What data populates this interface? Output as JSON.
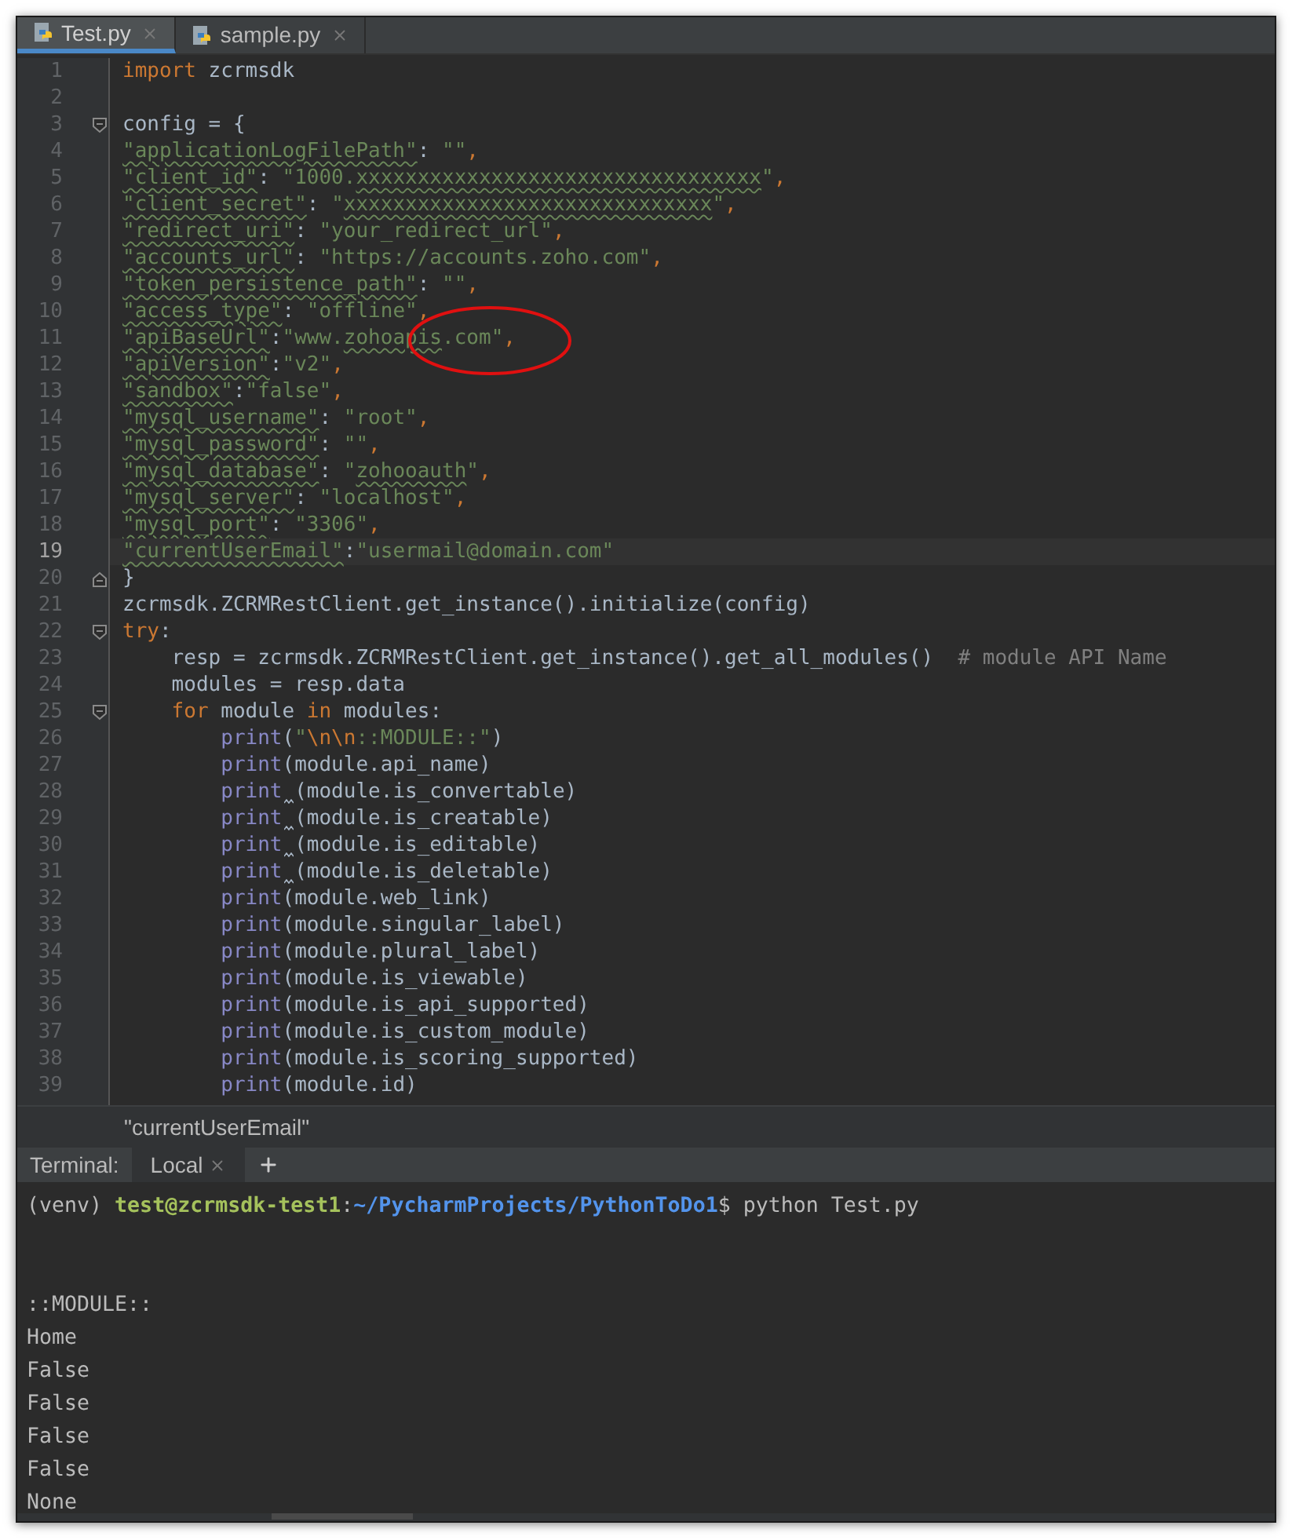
{
  "editor_tabs": [
    {
      "label": "Test.py",
      "selected": true
    },
    {
      "label": "sample.py",
      "selected": false
    }
  ],
  "code_lines": [
    {
      "number": "1",
      "tokens": [
        {
          "text": "import",
          "kind": "keyword"
        },
        {
          "text": " zcrmsdk",
          "kind": "plain"
        }
      ]
    },
    {
      "number": "2"
    },
    {
      "number": "3",
      "fold": {
        "kind": "start"
      },
      "tokens": [
        {
          "text": "config = {",
          "kind": "plain"
        }
      ]
    },
    {
      "number": "4",
      "tokens": [
        {
          "text": "\"applicationLogFilePath\"",
          "kind": "string",
          "warned": true
        },
        {
          "text": ": ",
          "kind": "plain"
        },
        {
          "text": "\"\"",
          "kind": "string"
        },
        {
          "text": ",",
          "kind": "punct"
        }
      ]
    },
    {
      "number": "5",
      "tokens": [
        {
          "text": "\"client_id\"",
          "kind": "string",
          "warned": true
        },
        {
          "text": ": ",
          "kind": "plain"
        },
        {
          "text": "\"1000.",
          "kind": "string"
        },
        {
          "text": "xxxxxxxxxxxxxxxxxxxxxxxxxxxxxxxxx",
          "kind": "string",
          "warned": true
        },
        {
          "text": "\"",
          "kind": "string"
        },
        {
          "text": ",",
          "kind": "punct"
        }
      ]
    },
    {
      "number": "6",
      "tokens": [
        {
          "text": "\"client_secret\"",
          "kind": "string",
          "warned": true
        },
        {
          "text": ": ",
          "kind": "plain"
        },
        {
          "text": "\"",
          "kind": "string"
        },
        {
          "text": "xxxxxxxxxxxxxxxxxxxxxxxxxxxxxx",
          "kind": "string",
          "warned": true
        },
        {
          "text": "\"",
          "kind": "string"
        },
        {
          "text": ",",
          "kind": "punct"
        }
      ]
    },
    {
      "number": "7",
      "tokens": [
        {
          "text": "\"redirect_uri\"",
          "kind": "string",
          "warned": true
        },
        {
          "text": ": ",
          "kind": "plain"
        },
        {
          "text": "\"your_redirect_url\"",
          "kind": "string"
        },
        {
          "text": ",",
          "kind": "punct"
        }
      ]
    },
    {
      "number": "8",
      "tokens": [
        {
          "text": "\"accounts_url\"",
          "kind": "string",
          "warned": true
        },
        {
          "text": ": ",
          "kind": "plain"
        },
        {
          "text": "\"https://accounts.zoho.com\"",
          "kind": "string"
        },
        {
          "text": ",",
          "kind": "punct"
        }
      ]
    },
    {
      "number": "9",
      "tokens": [
        {
          "text": "\"token_persistence_path\"",
          "kind": "string",
          "warned": true
        },
        {
          "text": ": ",
          "kind": "plain"
        },
        {
          "text": "\"\"",
          "kind": "string"
        },
        {
          "text": ",",
          "kind": "punct"
        }
      ]
    },
    {
      "number": "10",
      "tokens": [
        {
          "text": "\"access_type\"",
          "kind": "string",
          "warned": true
        },
        {
          "text": ": ",
          "kind": "plain"
        },
        {
          "text": "\"offline\"",
          "kind": "string"
        },
        {
          "text": ",",
          "kind": "punct"
        }
      ]
    },
    {
      "number": "11",
      "tokens": [
        {
          "text": "\"apiBaseUrl\"",
          "kind": "string",
          "warned": true
        },
        {
          "text": ":",
          "kind": "plain"
        },
        {
          "text": "\"www.",
          "kind": "string"
        },
        {
          "text": "zohoapis",
          "kind": "string",
          "warned": true
        },
        {
          "text": ".com\"",
          "kind": "string"
        },
        {
          "text": ",",
          "kind": "punct"
        }
      ]
    },
    {
      "number": "12",
      "tokens": [
        {
          "text": "\"apiVersion\"",
          "kind": "string",
          "warned": true
        },
        {
          "text": ":",
          "kind": "plain"
        },
        {
          "text": "\"v2\"",
          "kind": "string"
        },
        {
          "text": ",",
          "kind": "punct"
        }
      ]
    },
    {
      "number": "13",
      "tokens": [
        {
          "text": "\"sandbox\"",
          "kind": "string",
          "warned": true
        },
        {
          "text": ":",
          "kind": "plain"
        },
        {
          "text": "\"false\"",
          "kind": "string"
        },
        {
          "text": ",",
          "kind": "punct"
        }
      ]
    },
    {
      "number": "14",
      "tokens": [
        {
          "text": "\"mysql_username\"",
          "kind": "string",
          "warned": true
        },
        {
          "text": ": ",
          "kind": "plain"
        },
        {
          "text": "\"root\"",
          "kind": "string"
        },
        {
          "text": ",",
          "kind": "punct"
        }
      ]
    },
    {
      "number": "15",
      "tokens": [
        {
          "text": "\"mysql_password\"",
          "kind": "string",
          "warned": true
        },
        {
          "text": ": ",
          "kind": "plain"
        },
        {
          "text": "\"\"",
          "kind": "string"
        },
        {
          "text": ",",
          "kind": "punct"
        }
      ]
    },
    {
      "number": "16",
      "tokens": [
        {
          "text": "\"mysql_database\"",
          "kind": "string",
          "warned": true
        },
        {
          "text": ": ",
          "kind": "plain"
        },
        {
          "text": "\"",
          "kind": "string"
        },
        {
          "text": "zohooauth",
          "kind": "string",
          "warned": true
        },
        {
          "text": "\"",
          "kind": "string"
        },
        {
          "text": ",",
          "kind": "punct"
        }
      ]
    },
    {
      "number": "17",
      "tokens": [
        {
          "text": "\"mysql_server\"",
          "kind": "string",
          "warned": true
        },
        {
          "text": ": ",
          "kind": "plain"
        },
        {
          "text": "\"localhost\"",
          "kind": "string"
        },
        {
          "text": ",",
          "kind": "punct"
        }
      ]
    },
    {
      "number": "18",
      "tokens": [
        {
          "text": "\"mysql_port\"",
          "kind": "string",
          "warned": true
        },
        {
          "text": ": ",
          "kind": "plain"
        },
        {
          "text": "\"3306\"",
          "kind": "string"
        },
        {
          "text": ",",
          "kind": "punct"
        }
      ]
    },
    {
      "number": "19",
      "current": true,
      "tokens": [
        {
          "text": "\"currentUserEmail\"",
          "kind": "string",
          "warned": true
        },
        {
          "text": ":",
          "kind": "plain"
        },
        {
          "text": "\"usermail@domain.com\"",
          "kind": "string"
        }
      ]
    },
    {
      "number": "20",
      "fold": {
        "kind": "end"
      },
      "tokens": [
        {
          "text": "}",
          "kind": "plain"
        }
      ]
    },
    {
      "number": "21",
      "tokens": [
        {
          "text": "zcrmsdk.ZCRMRestClient.get_instance().initialize(config)",
          "kind": "plain"
        }
      ]
    },
    {
      "number": "22",
      "fold": {
        "kind": "start"
      },
      "tokens": [
        {
          "text": "try",
          "kind": "keyword"
        },
        {
          "text": ":",
          "kind": "plain"
        }
      ]
    },
    {
      "number": "23",
      "tokens": [
        {
          "text": "    resp = zcrmsdk.ZCRMRestClient.get_instance().get_all_modules()  ",
          "kind": "plain"
        },
        {
          "text": "# module API Name",
          "kind": "comment"
        }
      ]
    },
    {
      "number": "24",
      "tokens": [
        {
          "text": "    modules = resp.data",
          "kind": "plain"
        }
      ]
    },
    {
      "number": "25",
      "fold": {
        "kind": "start"
      },
      "tokens": [
        {
          "text": "    for",
          "kind": "keyword"
        },
        {
          "text": " module ",
          "kind": "plain"
        },
        {
          "text": "in",
          "kind": "keyword"
        },
        {
          "text": " modules:",
          "kind": "plain"
        }
      ]
    },
    {
      "number": "26",
      "tokens": [
        {
          "text": "        print",
          "kind": "builtin"
        },
        {
          "text": "(",
          "kind": "plain"
        },
        {
          "text": "\"",
          "kind": "string"
        },
        {
          "text": "\\n\\n",
          "kind": "escape"
        },
        {
          "text": "::MODULE::\"",
          "kind": "string"
        },
        {
          "text": ")",
          "kind": "plain"
        }
      ]
    },
    {
      "number": "27",
      "tokens": [
        {
          "text": "        print",
          "kind": "builtin"
        },
        {
          "text": "(module.api_name)",
          "kind": "plain"
        }
      ]
    },
    {
      "number": "28",
      "tokens": [
        {
          "text": "        print ",
          "kind": "builtin",
          "gap_warning": true
        },
        {
          "text": "(module.is_convertable)",
          "kind": "plain"
        }
      ]
    },
    {
      "number": "29",
      "tokens": [
        {
          "text": "        print ",
          "kind": "builtin",
          "gap_warning": true
        },
        {
          "text": "(module.is_creatable)",
          "kind": "plain"
        }
      ]
    },
    {
      "number": "30",
      "tokens": [
        {
          "text": "        print ",
          "kind": "builtin",
          "gap_warning": true
        },
        {
          "text": "(module.is_editable)",
          "kind": "plain"
        }
      ]
    },
    {
      "number": "31",
      "tokens": [
        {
          "text": "        print ",
          "kind": "builtin",
          "gap_warning": true
        },
        {
          "text": "(module.is_deletable)",
          "kind": "plain"
        }
      ]
    },
    {
      "number": "32",
      "tokens": [
        {
          "text": "        print",
          "kind": "builtin"
        },
        {
          "text": "(module.web_link)",
          "kind": "plain"
        }
      ]
    },
    {
      "number": "33",
      "tokens": [
        {
          "text": "        print",
          "kind": "builtin"
        },
        {
          "text": "(module.singular_label)",
          "kind": "plain"
        }
      ]
    },
    {
      "number": "34",
      "tokens": [
        {
          "text": "        print",
          "kind": "builtin"
        },
        {
          "text": "(module.plural_label)",
          "kind": "plain"
        }
      ]
    },
    {
      "number": "35",
      "tokens": [
        {
          "text": "        print",
          "kind": "builtin"
        },
        {
          "text": "(module.is_viewable)",
          "kind": "plain"
        }
      ]
    },
    {
      "number": "36",
      "tokens": [
        {
          "text": "        print",
          "kind": "builtin"
        },
        {
          "text": "(module.is_api_supported)",
          "kind": "plain"
        }
      ]
    },
    {
      "number": "37",
      "tokens": [
        {
          "text": "        print",
          "kind": "builtin"
        },
        {
          "text": "(module.is_custom_module)",
          "kind": "plain"
        }
      ]
    },
    {
      "number": "38",
      "tokens": [
        {
          "text": "        print",
          "kind": "builtin"
        },
        {
          "text": "(module.is_scoring_supported)",
          "kind": "plain"
        }
      ]
    },
    {
      "number": "39",
      "tokens": [
        {
          "text": "        print",
          "kind": "builtin"
        },
        {
          "text": "(module.id)",
          "kind": "plain"
        }
      ]
    }
  ],
  "breadcrumb": "\"currentUserEmail\"",
  "terminal": {
    "label": "Terminal:",
    "tabs": [
      {
        "label": "Local",
        "selected": true
      }
    ],
    "prompt": [
      {
        "text": "(venv) ",
        "kind": "plain"
      },
      {
        "text": "test@zcrmsdk-test1",
        "kind": "host"
      },
      {
        "text": ":",
        "kind": "plain"
      },
      {
        "text": "~/PycharmProjects/PythonToDo1",
        "kind": "path"
      },
      {
        "text": "$ python Test.py",
        "kind": "plain"
      }
    ],
    "output": [
      "::MODULE::",
      "Home",
      "False",
      "False",
      "False",
      "False",
      "None"
    ]
  }
}
